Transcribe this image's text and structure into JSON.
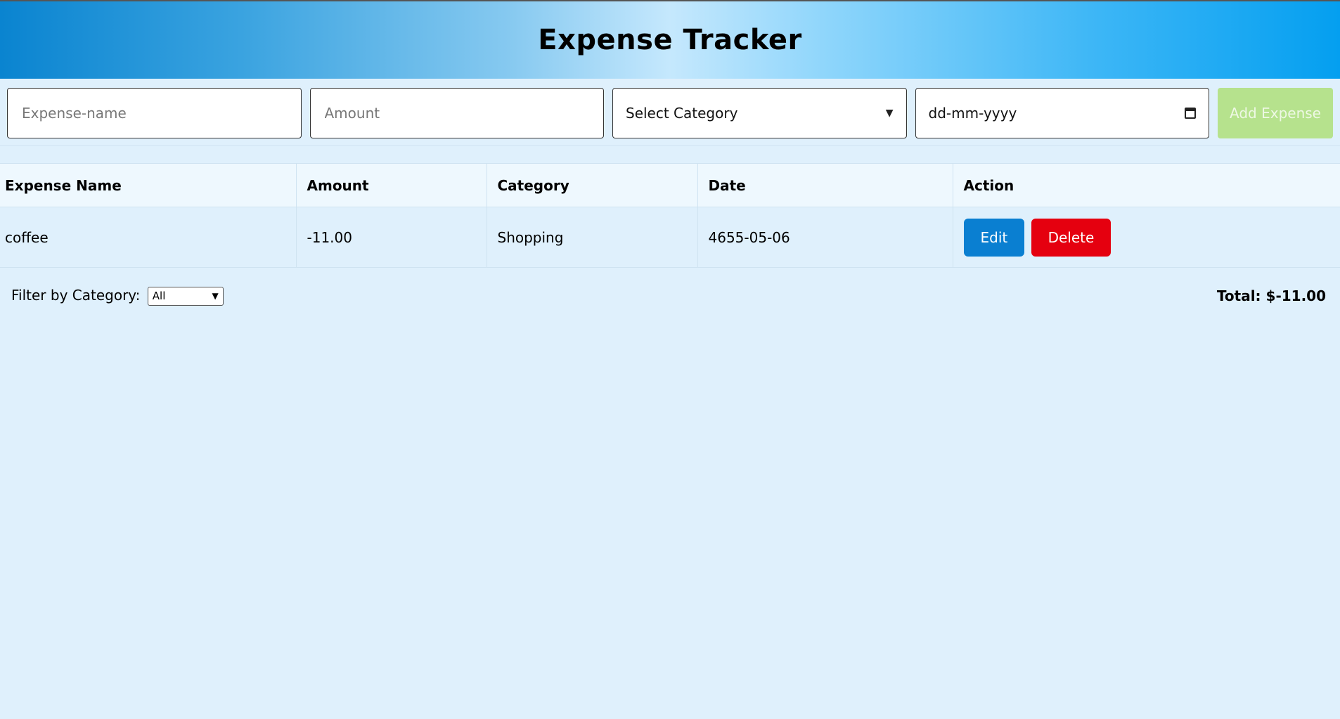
{
  "header": {
    "title": "Expense Tracker"
  },
  "form": {
    "name_placeholder": "Expense-name",
    "amount_placeholder": "Amount",
    "category_selected": "Select Category",
    "date_placeholder": "dd-mm-yyyy",
    "add_label": "Add Expense"
  },
  "table": {
    "headers": [
      "Expense Name",
      "Amount",
      "Category",
      "Date",
      "Action"
    ],
    "rows": [
      {
        "name": "coffee",
        "amount": "-11.00",
        "category": "Shopping",
        "date": "4655-05-06",
        "edit_label": "Edit",
        "delete_label": "Delete"
      }
    ]
  },
  "footer": {
    "filter_label": "Filter by Category:",
    "filter_selected": "All",
    "total_label": "Total: $-11.00"
  },
  "colors": {
    "edit": "#0a7fd1",
    "delete": "#e5000f",
    "add": "#b6e28d",
    "background": "#dff0fc"
  }
}
